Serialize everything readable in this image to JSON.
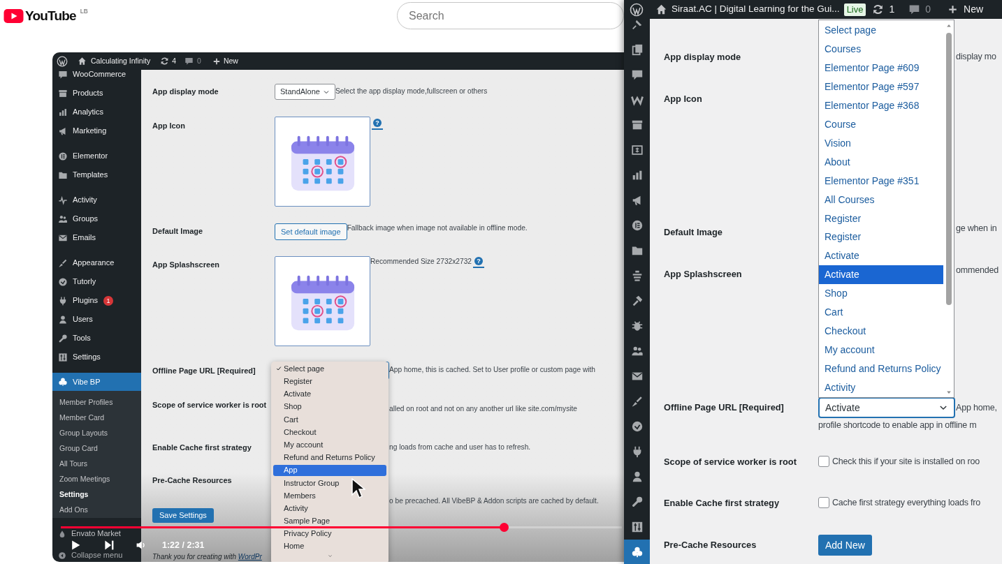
{
  "youtube": {
    "logo": "YouTube",
    "region": "LB",
    "search": {
      "placeholder": "Search"
    }
  },
  "video": {
    "admin_bar": {
      "site": "Calculating Infinity",
      "updates": "4",
      "comments": "0",
      "new": "New"
    },
    "sidebar": {
      "sections": [
        {
          "items": [
            {
              "label": "WooCommerce",
              "selected": false
            },
            {
              "label": "Products",
              "selected": false
            },
            {
              "label": "Analytics",
              "selected": false
            },
            {
              "label": "Marketing",
              "selected": false
            }
          ]
        },
        {
          "items": [
            {
              "label": "Elementor",
              "selected": false
            },
            {
              "label": "Templates",
              "selected": false
            }
          ]
        },
        {
          "items": [
            {
              "label": "Activity",
              "selected": false
            },
            {
              "label": "Groups",
              "selected": false
            },
            {
              "label": "Emails",
              "selected": false
            }
          ]
        },
        {
          "items": [
            {
              "label": "Appearance",
              "selected": false
            },
            {
              "label": "Tutorly",
              "selected": false
            },
            {
              "label": "Plugins",
              "selected": false,
              "badge": "1"
            },
            {
              "label": "Users",
              "selected": false
            },
            {
              "label": "Tools",
              "selected": false
            },
            {
              "label": "Settings",
              "selected": false
            }
          ]
        },
        {
          "items": [
            {
              "label": "Vibe BP",
              "selected": true,
              "children": [
                {
                  "label": "Member Profiles",
                  "selected": false
                },
                {
                  "label": "Member Card",
                  "selected": false
                },
                {
                  "label": "Group Layouts",
                  "selected": false
                },
                {
                  "label": "Group Card",
                  "selected": false
                },
                {
                  "label": "All Tours",
                  "selected": false
                },
                {
                  "label": "Zoom Meetings",
                  "selected": false
                },
                {
                  "label": "Settings",
                  "selected": true
                },
                {
                  "label": "Add Ons",
                  "selected": false
                }
              ]
            }
          ]
        },
        {
          "items": [
            {
              "label": "Envato Market",
              "selected": false
            },
            {
              "label": "Collapse menu",
              "selected": false
            }
          ]
        }
      ]
    },
    "settings": [
      {
        "kind": "select",
        "label": "App display mode",
        "value": "StandAlone",
        "description": "Select the app display mode,fullscreen or others"
      },
      {
        "kind": "image",
        "label": "App Icon",
        "help": "?"
      },
      {
        "kind": "button",
        "label": "Default Image",
        "button": "Set default image",
        "description": "Fallback image when image not available in offline mode."
      },
      {
        "kind": "image",
        "label": "App Splashscreen",
        "description": "Recommended Size 2732x2732",
        "help": "?"
      },
      {
        "kind": "select_open",
        "label": "Offline Page URL [Required]",
        "description": "App home, this is cached. Set to User profile or custom page with"
      },
      {
        "kind": "text",
        "label": "Scope of service worker is root",
        "description": "alled on root and not on any another url like site.com/mysite"
      },
      {
        "kind": "text",
        "label": "Enable Cache first strategy",
        "description": "ng loads from cache and user has to refresh."
      },
      {
        "kind": "text",
        "label": "Pre-Cache Resources",
        "description": "o be precached. All VibeBP & Addon scripts are cached by default."
      }
    ],
    "save_button": "Save Settings",
    "footer": {
      "text": "Thank you for creating with ",
      "link": "WordPr"
    },
    "dropdown": {
      "options": [
        {
          "label": "Select page",
          "checked": true,
          "selected": false
        },
        {
          "label": "Register",
          "checked": false,
          "selected": false
        },
        {
          "label": "Activate",
          "checked": false,
          "selected": false
        },
        {
          "label": "Shop",
          "checked": false,
          "selected": false
        },
        {
          "label": "Cart",
          "checked": false,
          "selected": false
        },
        {
          "label": "Checkout",
          "checked": false,
          "selected": false
        },
        {
          "label": "My account",
          "checked": false,
          "selected": false
        },
        {
          "label": "Refund and Returns Policy",
          "checked": false,
          "selected": false
        },
        {
          "label": "App",
          "checked": false,
          "selected": true
        },
        {
          "label": "Instructor Group",
          "checked": false,
          "selected": false
        },
        {
          "label": "Members",
          "checked": false,
          "selected": false
        },
        {
          "label": "Activity",
          "checked": false,
          "selected": false
        },
        {
          "label": "Sample Page",
          "checked": false,
          "selected": false
        },
        {
          "label": "Privacy Policy",
          "checked": false,
          "selected": false
        },
        {
          "label": "Home",
          "checked": false,
          "selected": false
        }
      ]
    },
    "player": {
      "level": 0.79,
      "time": "1:22 / 2:31"
    }
  },
  "admin_window": {
    "admin_bar": {
      "site": "Siraat.AC | Digital Learning for the Gui...",
      "status": "Live",
      "updates": "1",
      "comments": "0",
      "new": "New"
    },
    "icon_menu": [
      {
        "selected": false
      },
      {
        "selected": false
      },
      {
        "selected": false
      },
      {
        "selected": false
      },
      {
        "selected": false
      },
      {
        "selected": false
      },
      {
        "selected": false
      },
      {
        "selected": false
      },
      {
        "selected": false
      },
      {
        "selected": false
      },
      {
        "selected": false
      },
      {
        "selected": false
      },
      {
        "selected": false
      },
      {
        "selected": false
      },
      {
        "selected": false
      },
      {
        "selected": false
      },
      {
        "selected": false
      },
      {
        "selected": false
      },
      {
        "selected": false
      },
      {
        "selected": false
      },
      {
        "selected": false
      },
      {
        "selected": true
      }
    ],
    "settings": [
      {
        "kind": "text",
        "label": "App display mode",
        "description": "display mo"
      },
      {
        "kind": "blank",
        "label": "App Icon"
      },
      {
        "kind": "text",
        "label": "Default Image",
        "description": "ge when in"
      },
      {
        "kind": "text",
        "label": "App Splashscreen",
        "description": "ommended"
      },
      {
        "kind": "select",
        "label": "Offline Page URL [Required]",
        "value": "Activate",
        "description": "App home,",
        "note": "profile shortcode to enable app in offline m"
      },
      {
        "kind": "checkbox",
        "label": "Scope of service worker is root",
        "checked": false,
        "description": "Check this if your site is installed on roo"
      },
      {
        "kind": "checkbox",
        "label": "Enable Cache first strategy",
        "checked": false,
        "description": "Cache first strategy everything loads fro"
      },
      {
        "kind": "button",
        "label": "Pre-Cache Resources",
        "button": "Add New"
      }
    ],
    "dropdown": {
      "options": [
        {
          "label": "Select page",
          "selected": false
        },
        {
          "label": "Courses",
          "selected": false
        },
        {
          "label": "Elementor Page #609",
          "selected": false
        },
        {
          "label": "Elementor Page #597",
          "selected": false
        },
        {
          "label": "Elementor Page #368",
          "selected": false
        },
        {
          "label": "Course",
          "selected": false
        },
        {
          "label": "Vision",
          "selected": false
        },
        {
          "label": "About",
          "selected": false
        },
        {
          "label": "Elementor Page #351",
          "selected": false
        },
        {
          "label": "All Courses",
          "selected": false
        },
        {
          "label": "Register",
          "selected": false
        },
        {
          "label": "Register",
          "selected": false
        },
        {
          "label": "Activate",
          "selected": false
        },
        {
          "label": "Activate",
          "selected": true
        },
        {
          "label": "Shop",
          "selected": false
        },
        {
          "label": "Cart",
          "selected": false
        },
        {
          "label": "Checkout",
          "selected": false
        },
        {
          "label": "My account",
          "selected": false
        },
        {
          "label": "Refund and Returns Policy",
          "selected": false
        },
        {
          "label": "Activity",
          "selected": false
        }
      ]
    }
  }
}
